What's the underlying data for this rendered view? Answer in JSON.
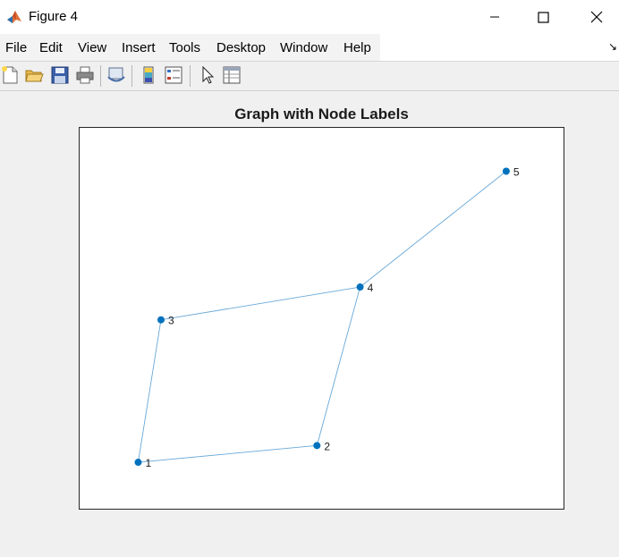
{
  "window": {
    "title": "Figure 4",
    "controls": [
      "minimize",
      "maximize",
      "close"
    ]
  },
  "menu": {
    "items": [
      "File",
      "Edit",
      "View",
      "Insert",
      "Tools",
      "Desktop",
      "Window",
      "Help"
    ]
  },
  "toolbar": {
    "buttons": [
      "new-figure-icon",
      "open-file-icon",
      "save-icon",
      "print-icon",
      "link-plot-icon",
      "colorbar-icon",
      "legend-icon",
      "pointer-icon",
      "property-inspector-icon"
    ]
  },
  "colors": {
    "node": "#0072bd",
    "edge": "#68a8d8",
    "axes_border": "#262626"
  },
  "chart_data": {
    "type": "graph",
    "title": "Graph with Node Labels",
    "grid": false,
    "nodes": [
      {
        "id": "1",
        "x": 0,
        "y": 0
      },
      {
        "id": "2",
        "x": 2.9,
        "y": 0.27
      },
      {
        "id": "3",
        "x": 0.37,
        "y": 2.3
      },
      {
        "id": "4",
        "x": 3.6,
        "y": 2.83
      },
      {
        "id": "5",
        "x": 5.97,
        "y": 4.7
      }
    ],
    "edges": [
      [
        "1",
        "2"
      ],
      [
        "1",
        "3"
      ],
      [
        "2",
        "4"
      ],
      [
        "3",
        "4"
      ],
      [
        "4",
        "5"
      ]
    ],
    "xlim": [
      -0.95,
      6.9
    ],
    "ylim": [
      -0.75,
      5.4
    ]
  }
}
